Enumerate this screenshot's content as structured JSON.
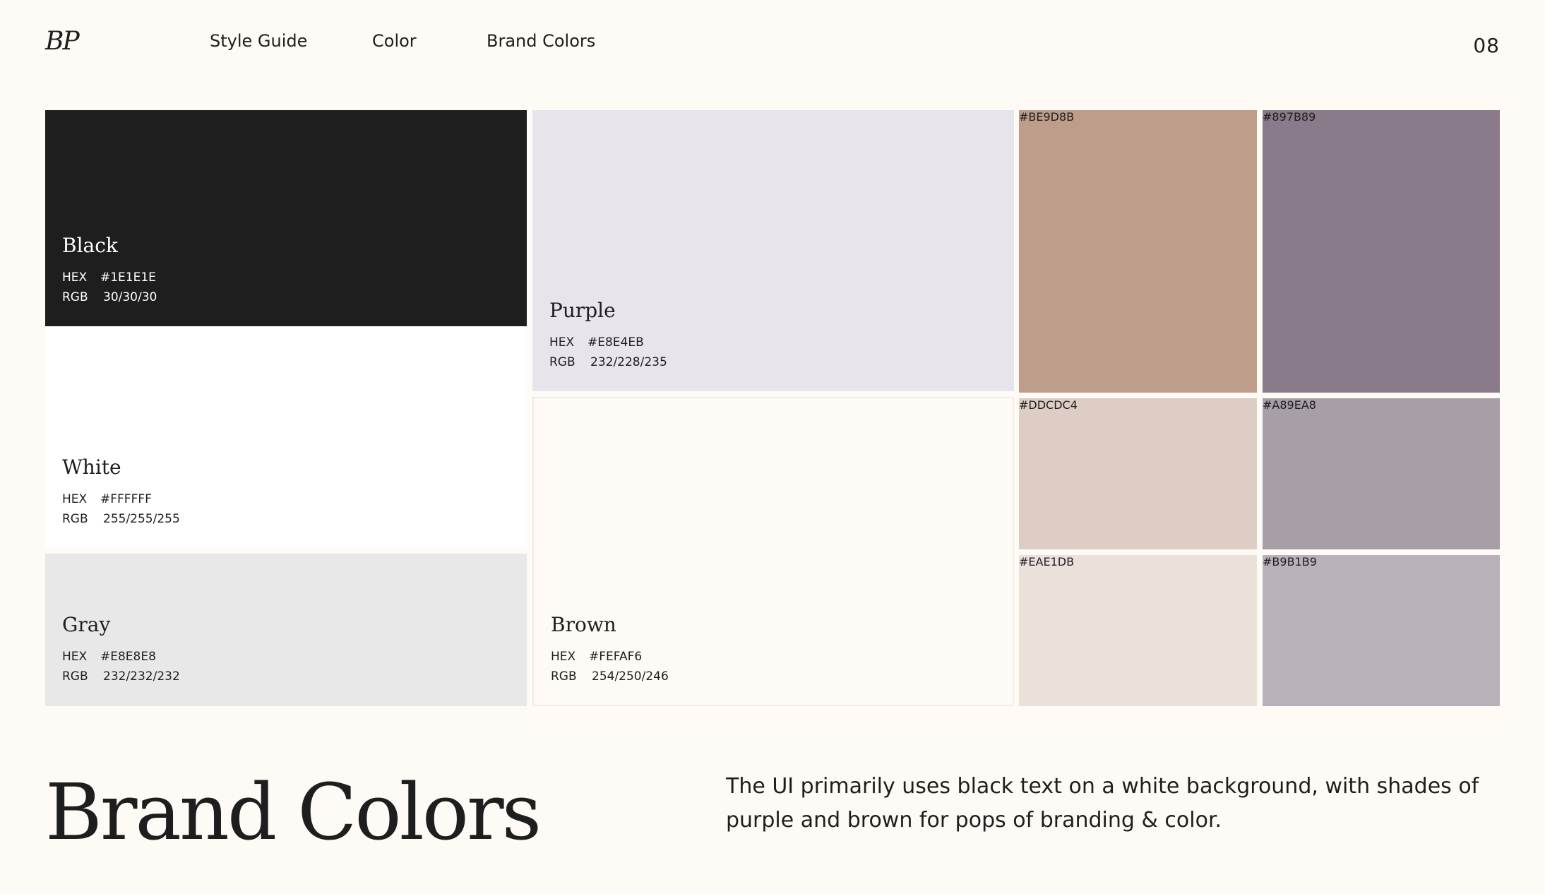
{
  "header": {
    "logo": "BP",
    "nav": [
      "Style Guide",
      "Color",
      "Brand Colors"
    ],
    "page_number": "08"
  },
  "primary_swatches": {
    "black": {
      "name": "Black",
      "hex_label": "HEX",
      "hex": "#1E1E1E",
      "rgb_label": "RGB",
      "rgb": "30/30/30"
    },
    "white": {
      "name": "White",
      "hex_label": "HEX",
      "hex": "#FFFFFF",
      "rgb_label": "RGB",
      "rgb": "255/255/255"
    },
    "gray": {
      "name": "Gray",
      "hex_label": "HEX",
      "hex": "#E8E8E8",
      "rgb_label": "RGB",
      "rgb": "232/232/232"
    },
    "purple": {
      "name": "Purple",
      "hex_label": "HEX",
      "hex": "#E8E4EB",
      "rgb_label": "RGB",
      "rgb": "232/228/235"
    },
    "brown": {
      "name": "Brown",
      "hex_label": "HEX",
      "hex": "#FEFAF6",
      "rgb_label": "RGB",
      "rgb": "254/250/246"
    }
  },
  "accent_swatches": [
    {
      "hex": "#BE9D8B"
    },
    {
      "hex": "#897B89"
    },
    {
      "hex": "#DDCDC4"
    },
    {
      "hex": "#A89EA8"
    },
    {
      "hex": "#EAE1DB"
    },
    {
      "hex": "#B9B1B9"
    }
  ],
  "footer": {
    "title": "Brand Colors",
    "description": "The UI primarily uses black text on a white background, with shades of purple and brown for pops of  branding & color."
  }
}
